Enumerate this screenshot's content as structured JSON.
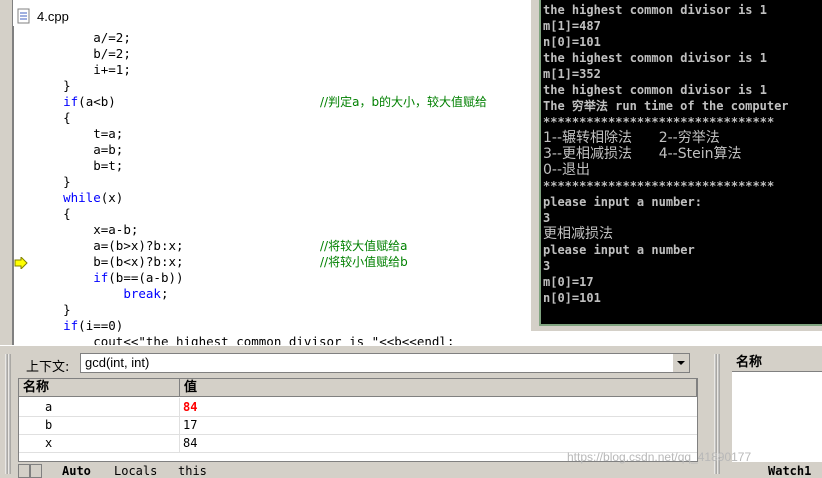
{
  "editor": {
    "filename": "4.cpp",
    "code_lines": [
      {
        "indent": "        ",
        "text": "a/=2;",
        "kind": "plain"
      },
      {
        "indent": "        ",
        "text": "b/=2;",
        "kind": "plain"
      },
      {
        "indent": "        ",
        "text": "i+=1;",
        "kind": "plain"
      },
      {
        "indent": "    ",
        "text": "}",
        "kind": "plain"
      },
      {
        "indent": "    ",
        "kw": "if",
        "text": "(a<b)",
        "comment": "//判定a，b的大小，较大值赋给",
        "kind": "kwcomment"
      },
      {
        "indent": "    ",
        "text": "{",
        "kind": "plain"
      },
      {
        "indent": "        ",
        "text": "t=a;",
        "kind": "plain"
      },
      {
        "indent": "        ",
        "text": "a=b;",
        "kind": "plain"
      },
      {
        "indent": "        ",
        "text": "b=t;",
        "kind": "plain"
      },
      {
        "indent": "    ",
        "text": "}",
        "kind": "plain"
      },
      {
        "indent": "    ",
        "kw": "while",
        "text": "(x)",
        "kind": "kw"
      },
      {
        "indent": "    ",
        "text": "{",
        "kind": "plain"
      },
      {
        "indent": "        ",
        "text": "x=a-b;",
        "kind": "plain"
      },
      {
        "indent": "        ",
        "text": "a=(b>x)?b:x;",
        "comment": "//将较大值赋给a",
        "kind": "comment"
      },
      {
        "indent": "        ",
        "text": "b=(b<x)?b:x;",
        "comment": "//将较小值赋给b",
        "kind": "comment"
      },
      {
        "indent": "        ",
        "kw": "if",
        "text": "(b==(a-b))",
        "kind": "kw"
      },
      {
        "indent": "            ",
        "kw": "break",
        "text": ";",
        "kind": "kw"
      },
      {
        "indent": "    ",
        "text": "}",
        "kind": "plain"
      },
      {
        "indent": "    ",
        "kw": "if",
        "text": "(i==0)",
        "kind": "kw"
      },
      {
        "indent": "        ",
        "text": "cout<<\"the highest common divisor is \"<<b<<endl;",
        "kind": "plain"
      }
    ]
  },
  "console": {
    "lines": [
      {
        "text": "the highest common divisor is 1",
        "cn": false
      },
      {
        "text": "m[1]=487",
        "cn": false
      },
      {
        "text": "n[0]=101",
        "cn": false
      },
      {
        "text": "the highest common divisor is 1",
        "cn": false
      },
      {
        "text": "m[1]=352",
        "cn": false
      },
      {
        "text": "the highest common divisor is 1",
        "cn": false
      },
      {
        "text": "The 穷举法 run time of the computer",
        "cn": false
      },
      {
        "text": "********************************",
        "cn": false
      },
      {
        "text": "1--辗转相除法      2--穷举法",
        "cn": true
      },
      {
        "text": "3--更相减损法      4--Stein算法",
        "cn": true
      },
      {
        "text": "0--退出",
        "cn": true
      },
      {
        "text": "********************************",
        "cn": false
      },
      {
        "text": "please input a number:",
        "cn": false
      },
      {
        "text": "3",
        "cn": false
      },
      {
        "text": "更相减损法",
        "cn": true
      },
      {
        "text": "please input a number",
        "cn": false
      },
      {
        "text": "3",
        "cn": false
      },
      {
        "text": "m[0]=17",
        "cn": false
      },
      {
        "text": "n[0]=101",
        "cn": false
      }
    ]
  },
  "variables": {
    "context_label": "上下文:",
    "context_value": "gcd(int, int)",
    "col_name": "名称",
    "col_value": "值",
    "rows": [
      {
        "name": "a",
        "value": "84",
        "changed": true
      },
      {
        "name": "b",
        "value": "17",
        "changed": false
      },
      {
        "name": "x",
        "value": "84",
        "changed": false
      }
    ],
    "tabs": [
      "Auto",
      "Locals",
      "this"
    ]
  },
  "watch": {
    "col_name": "名称",
    "tab": "Watch1"
  },
  "watermark": "https://blog.csdn.net/qq_41890177",
  "colors": {
    "keyword": "#0000ff",
    "comment": "#008000",
    "changed_value": "#ff0000",
    "console_bg": "#000000",
    "console_text": "#c0c0c0"
  }
}
